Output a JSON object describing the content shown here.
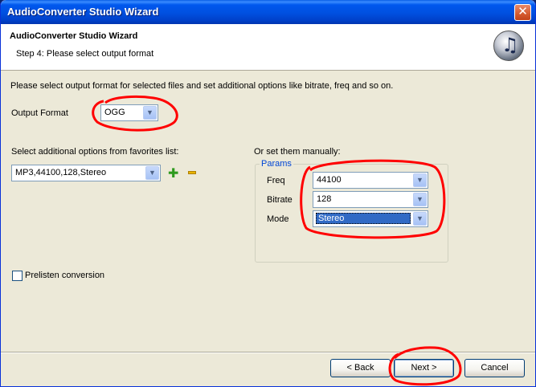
{
  "window": {
    "title": "AudioConverter Studio Wizard",
    "close_glyph": "✕"
  },
  "header": {
    "title": "AudioConverter Studio Wizard",
    "step": "Step 4: Please select output format",
    "logo_icon": "music-disc-icon"
  },
  "main": {
    "intro": "Please select output format for selected files and set additional options like bitrate, freq and so on.",
    "output_format_label": "Output Format",
    "output_format_value": "OGG",
    "favorites_label": "Select additional options from favorites list:",
    "favorites_value": "MP3,44100,128,Stereo",
    "manual_label": "Or set them manually:",
    "params_legend": "Params",
    "freq_label": "Freq",
    "freq_value": "44100",
    "bitrate_label": "Bitrate",
    "bitrate_value": "128",
    "mode_label": "Mode",
    "mode_value": "Stereo",
    "prelisten_label": "Prelisten conversion",
    "prelisten_checked": false
  },
  "footer": {
    "back_label": "< Back",
    "next_label": "Next >",
    "cancel_label": "Cancel"
  },
  "colors": {
    "accent": "#0058ee",
    "annotation": "#ff0000",
    "selection": "#316ac5"
  }
}
